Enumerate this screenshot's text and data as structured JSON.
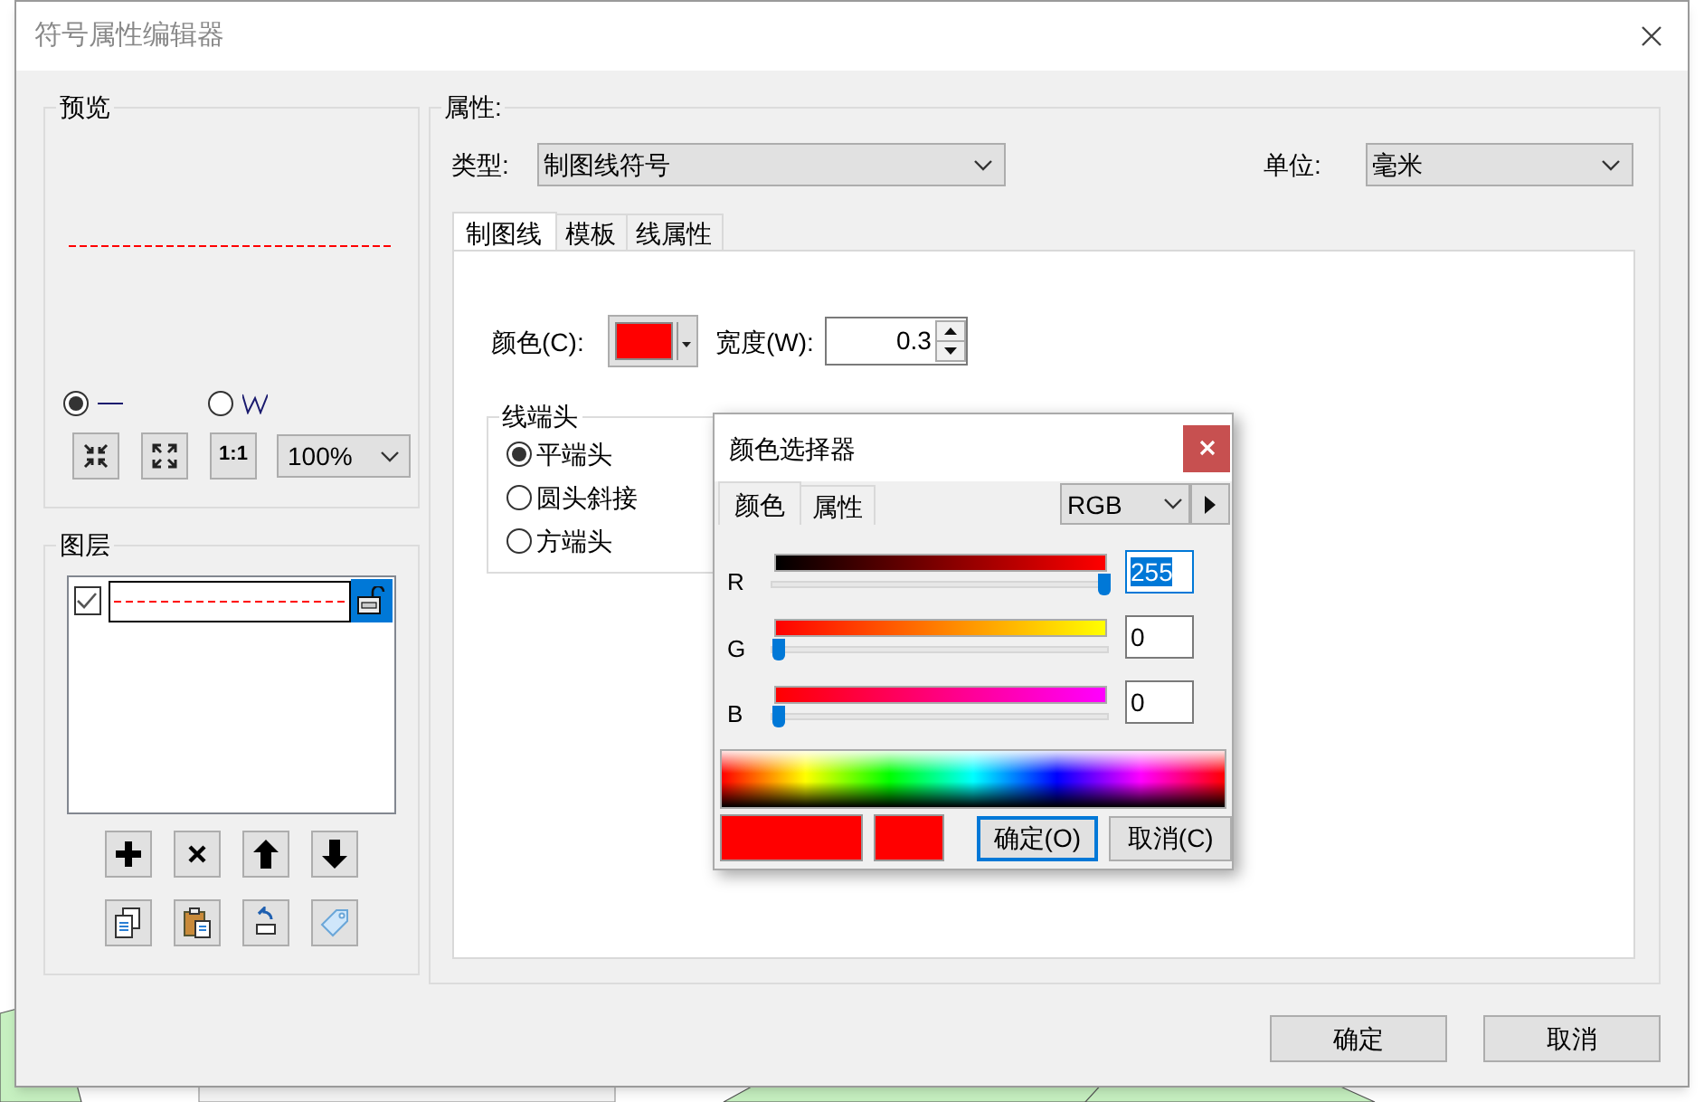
{
  "window": {
    "title": "符号属性编辑器"
  },
  "preview": {
    "title": "预览",
    "line": {
      "color": "#ff0000"
    },
    "styles": [
      {
        "kind": "straight",
        "selected": true
      },
      {
        "kind": "zigzag",
        "selected": false
      }
    ],
    "zoom": "100%",
    "zoom_buttons": [
      {
        "kind": "shrink"
      },
      {
        "kind": "expand"
      },
      {
        "kind": "actual",
        "label": "1:1"
      }
    ]
  },
  "layers": {
    "title": "图层",
    "items": [
      {
        "checked": true,
        "color": "#ff0000",
        "selected": true
      }
    ],
    "buttons": [
      {
        "kind": "add"
      },
      {
        "kind": "delete"
      },
      {
        "kind": "up"
      },
      {
        "kind": "down"
      },
      {
        "kind": "copy"
      },
      {
        "kind": "paste"
      },
      {
        "kind": "reset"
      },
      {
        "kind": "tag"
      }
    ]
  },
  "properties": {
    "title": "属性:",
    "type_label": "类型:",
    "type_value": "制图线符号",
    "unit_label": "单位:",
    "unit_value": "毫米",
    "tabs": [
      {
        "label": "制图线",
        "selected": true
      },
      {
        "label": "模板",
        "selected": false
      },
      {
        "label": "线属性",
        "selected": false
      }
    ],
    "color_label": "颜色(C):",
    "color": "#ff0000",
    "width_label": "宽度(W):",
    "width_value": "0.3",
    "cap": {
      "title": "线端头",
      "options": [
        {
          "label": "平端头",
          "selected": true
        },
        {
          "label": "圆头斜接",
          "selected": false
        },
        {
          "label": "方端头",
          "selected": false
        }
      ]
    }
  },
  "color_picker": {
    "title": "颜色选择器",
    "tabs": [
      {
        "label": "颜色",
        "selected": true
      },
      {
        "label": "属性",
        "selected": false
      }
    ],
    "model": "RGB",
    "channels": [
      {
        "name": "R",
        "level": 1,
        "value": "255",
        "focused": true
      },
      {
        "name": "G",
        "level": 0,
        "value": "0",
        "focused": false
      },
      {
        "name": "B",
        "level": 0,
        "value": "0",
        "focused": false
      }
    ],
    "swatches": [
      {
        "kind": "new",
        "color": "#ff0000"
      },
      {
        "kind": "old",
        "color": "#ff0000"
      }
    ],
    "ok": "确定(O)",
    "cancel": "取消(C)"
  },
  "buttons": [
    {
      "label": "确定"
    },
    {
      "label": "取消"
    }
  ]
}
